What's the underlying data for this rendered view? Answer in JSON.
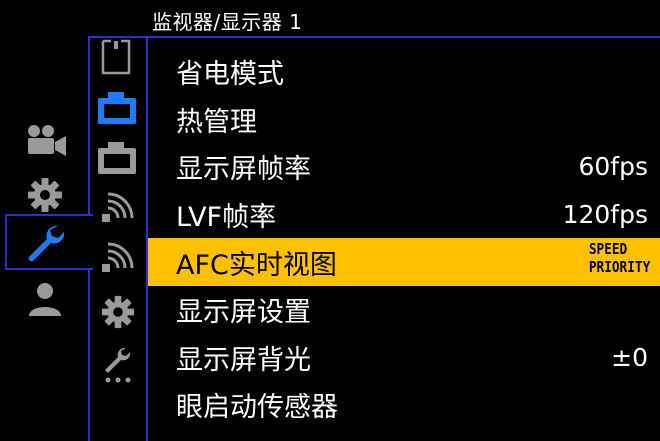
{
  "header": {
    "title": "监视器/显示器 1"
  },
  "menu": {
    "items": [
      {
        "label": "省电模式",
        "value": ""
      },
      {
        "label": "热管理",
        "value": ""
      },
      {
        "label": "显示屏帧率",
        "value": "60fps"
      },
      {
        "label": "LVF帧率",
        "value": "120fps"
      },
      {
        "label": "AFC实时视图",
        "value_line1": "SPEED",
        "value_line2": "PRIORITY"
      },
      {
        "label": "显示屏设置",
        "value": ""
      },
      {
        "label": "显示屏背光",
        "value": "±0"
      },
      {
        "label": "眼启动传感器",
        "value": ""
      }
    ]
  },
  "colors": {
    "accent": "#2b2fd0",
    "highlight": "#ffc000",
    "active_icon": "#1e7bff",
    "inactive_icon": "#9a9a9a"
  },
  "icons": {
    "left_tabs": [
      "video-camera-icon",
      "gear-icon",
      "wrench-icon",
      "person-icon"
    ],
    "sub_tabs": [
      "card-icon",
      "camera-active-icon",
      "camera-icon",
      "wireless-1-icon",
      "wireless-2-icon",
      "gear-small-icon",
      "wrench-small-icon"
    ]
  }
}
